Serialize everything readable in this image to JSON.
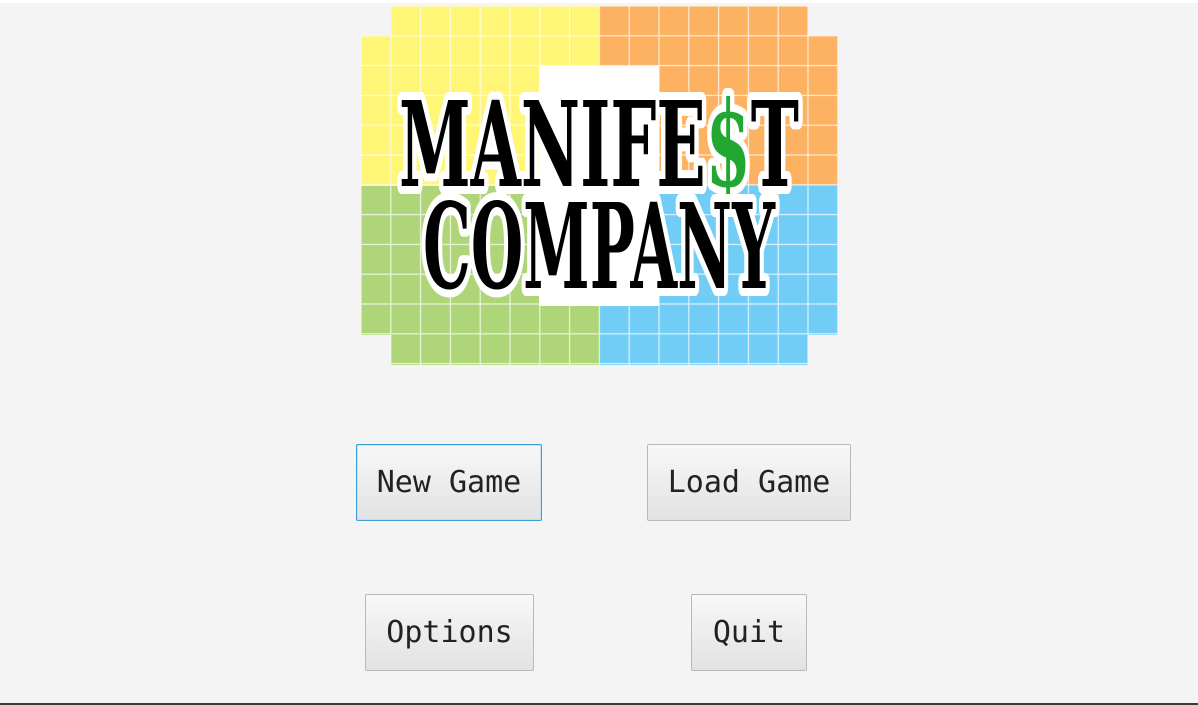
{
  "menu": {
    "new_game_label": "New Game",
    "load_game_label": "Load Game",
    "options_label": "Options",
    "quit_label": "Quit"
  },
  "logo": {
    "line1_part1": "MANIFE",
    "line1_dollar": "$",
    "line1_part2": "T",
    "line2": "COMPANY",
    "colors": {
      "yellow": "#fff576",
      "orange": "#fdb262",
      "green": "#aed678",
      "blue": "#71cdf6",
      "dollar": "#22a832",
      "text": "#000000"
    }
  },
  "colors": {
    "background": "#f4f4f4",
    "button_focus_border": "#3ba0d8"
  }
}
